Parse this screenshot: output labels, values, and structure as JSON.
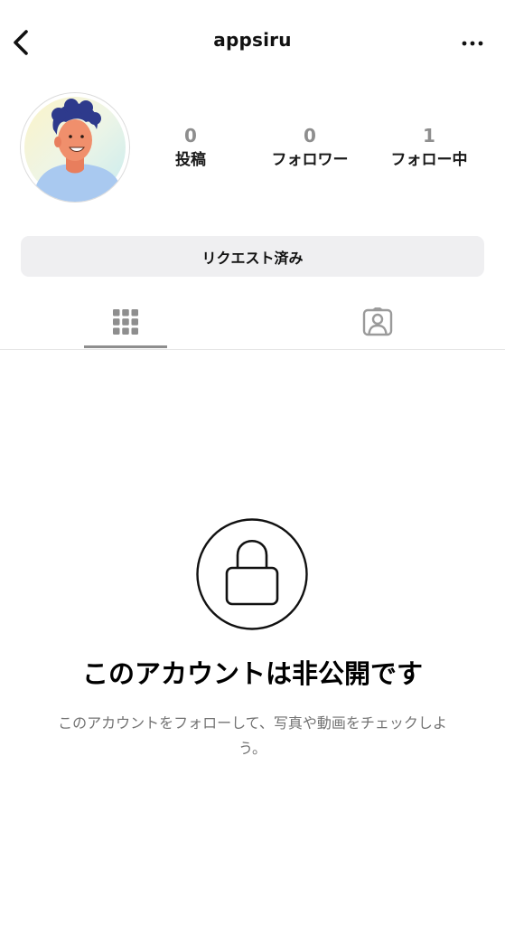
{
  "header": {
    "username": "appsiru"
  },
  "profile": {
    "stats": [
      {
        "value": "0",
        "label": "投稿"
      },
      {
        "value": "0",
        "label": "フォロワー"
      },
      {
        "value": "1",
        "label": "フォロー中"
      }
    ],
    "request_button_label": "リクエスト済み"
  },
  "tabs": {
    "active": "grid",
    "items": [
      "grid-icon",
      "tagged-icon"
    ]
  },
  "private": {
    "title": "このアカウントは非公開です",
    "description": "このアカウントをフォローして、写真や動画をチェックしよう。"
  },
  "colors": {
    "button_bg": "#efeff1",
    "muted_text": "#737373",
    "stat_number": "#8e8e8e"
  }
}
